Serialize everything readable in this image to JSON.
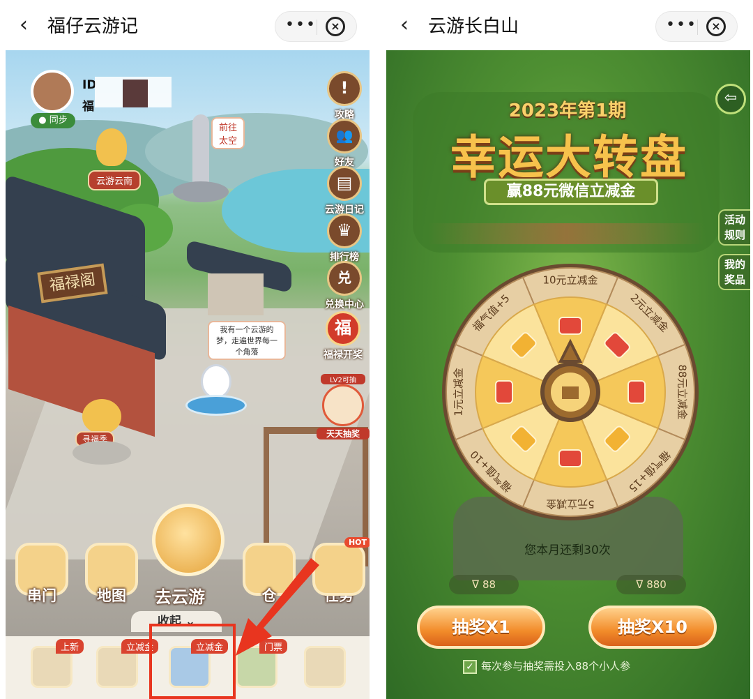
{
  "left": {
    "navbar": {
      "title": "福仔云游记",
      "back_icon": "chevron-left-icon",
      "more_icon": "more-dots-icon",
      "close_icon": "close-circle-icon"
    },
    "profile": {
      "id_label": "ID",
      "fu_label": "福",
      "sync_label": "同步"
    },
    "scene": {
      "space_bubble": "前往\n太空",
      "yunnan_tag": "云游云南",
      "hall_plaque": "福禄阁",
      "dream_bubble": "我有一个云游的梦，走遍世界每一个角落",
      "xunfu_tag": "寻福季"
    },
    "side_buttons": [
      {
        "label": "攻略",
        "icon": "exclamation-icon",
        "glyph": "!"
      },
      {
        "label": "好友",
        "icon": "friends-icon",
        "glyph": "👥"
      },
      {
        "label": "云游日记",
        "icon": "diary-icon",
        "glyph": "▤"
      },
      {
        "label": "排行榜",
        "icon": "ranking-icon",
        "glyph": "♛"
      },
      {
        "label": "兑换中心",
        "icon": "exchange-icon",
        "glyph": "兑"
      }
    ],
    "fulu_lottery": {
      "label": "福禄开奖",
      "glyph": "福"
    },
    "daily_draw": {
      "label": "天天抽奖",
      "unlock": "LV2可抽"
    },
    "bottom_buttons": [
      {
        "label": "串门",
        "icon": "house-icon"
      },
      {
        "label": "地图",
        "icon": "map-icon"
      },
      {
        "label": "仓",
        "icon": "backpack-icon"
      },
      {
        "label": "任务",
        "icon": "clipboard-icon",
        "badge": "HOT"
      }
    ],
    "go_travel": {
      "label": "去云游"
    },
    "collapse": {
      "label": "收起"
    },
    "tray": [
      {
        "badge": "上新"
      },
      {
        "badge": "立减金"
      },
      {
        "badge": "立减金"
      },
      {
        "badge": "门票"
      },
      {
        "badge": ""
      }
    ]
  },
  "right": {
    "navbar": {
      "title": "云游长白山",
      "back_icon": "chevron-left-icon",
      "more_icon": "more-dots-icon",
      "close_icon": "close-circle-icon"
    },
    "banner": {
      "period": "2023年第1期",
      "title": "幸运大转盘",
      "subtitle": "赢88元微信立减金"
    },
    "side_tabs": [
      {
        "label": "活动\n规则"
      },
      {
        "label": "我的\n奖品"
      }
    ],
    "wheel": {
      "segments": [
        "10元立减金",
        "2元立减金",
        "88元立减金",
        "福气值+15",
        "5元立减金",
        "福气值+10",
        "1元立减金",
        "福气值+5"
      ],
      "colors": {
        "dark": "#f5c85a",
        "light": "#fbe39c",
        "rim": "#6a4a30",
        "hub": "#9c6a2e"
      }
    },
    "remaining": "您本月还剩30次",
    "stats": {
      "left": "88",
      "right": "880"
    },
    "buttons": {
      "draw_one": "抽奖X1",
      "draw_ten": "抽奖X10"
    },
    "consent": "每次参与抽奖需投入88个小人参"
  }
}
